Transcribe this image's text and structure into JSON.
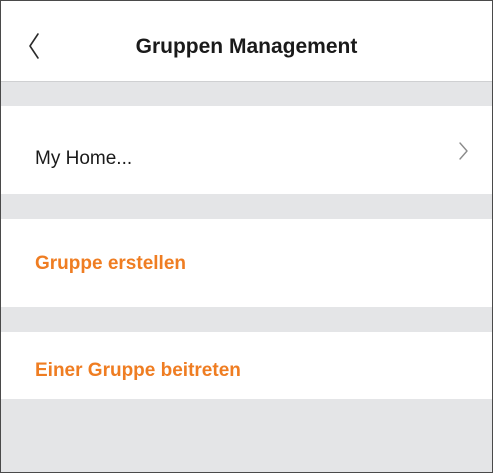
{
  "header": {
    "title": "Gruppen Management",
    "back_icon": "chevron-left-icon"
  },
  "groups": {
    "home_label": "My Home...",
    "chevron_icon": "chevron-right-icon"
  },
  "actions": {
    "create_label": "Gruppe erstellen",
    "join_label": "Einer Gruppe beitreten"
  },
  "colors": {
    "accent": "#ef7d22",
    "background": "#e4e5e7",
    "text": "#1a1a1a"
  }
}
